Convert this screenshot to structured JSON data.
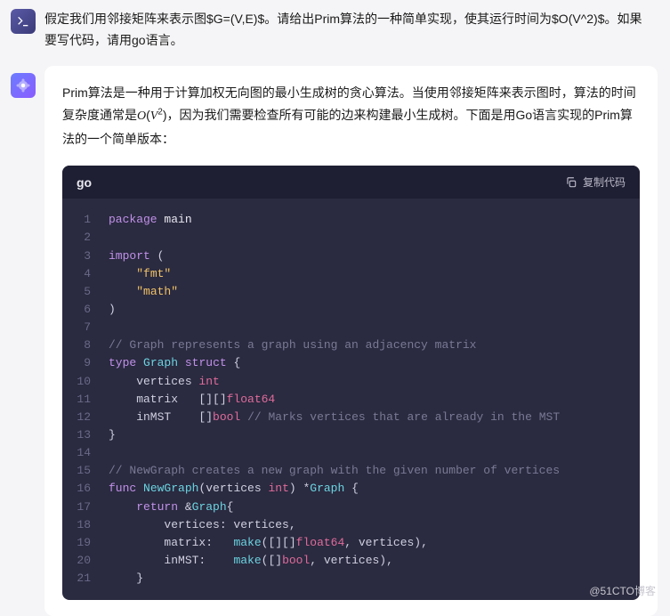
{
  "question": "假定我们用邻接矩阵来表示图$G=(V,E)$。请给出Prim算法的一种简单实现，使其运行时间为$O(V^2)$。如果要写代码，请用go语言。",
  "answer_prefix": "Prim算法是一种用于计算加权无向图的最小生成树的贪心算法。当使用邻接矩阵来表示图时，算法的时间复杂度通常是",
  "answer_math_O": "O",
  "answer_math_V": "V",
  "answer_math_exp": "2",
  "answer_suffix": "，因为我们需要检查所有可能的边来构建最小生成树。下面是用Go语言实现的Prim算法的一个简单版本：",
  "code": {
    "lang": "go",
    "copy_label": "复制代码",
    "lines": [
      {
        "n": "1",
        "seg": [
          {
            "c": "tk-kw",
            "t": "package"
          },
          {
            "c": "",
            "t": " "
          },
          {
            "c": "tk-pkg",
            "t": "main"
          }
        ]
      },
      {
        "n": "2",
        "seg": []
      },
      {
        "n": "3",
        "seg": [
          {
            "c": "tk-kw",
            "t": "import"
          },
          {
            "c": "",
            "t": " ("
          }
        ]
      },
      {
        "n": "4",
        "seg": [
          {
            "c": "",
            "t": "    "
          },
          {
            "c": "tk-str",
            "t": "\"fmt\""
          }
        ]
      },
      {
        "n": "5",
        "seg": [
          {
            "c": "",
            "t": "    "
          },
          {
            "c": "tk-str",
            "t": "\"math\""
          }
        ]
      },
      {
        "n": "6",
        "seg": [
          {
            "c": "",
            "t": ")"
          }
        ]
      },
      {
        "n": "7",
        "seg": []
      },
      {
        "n": "8",
        "seg": [
          {
            "c": "tk-cmt",
            "t": "// Graph represents a graph using an adjacency matrix"
          }
        ]
      },
      {
        "n": "9",
        "seg": [
          {
            "c": "tk-kw",
            "t": "type"
          },
          {
            "c": "",
            "t": " "
          },
          {
            "c": "tk-name",
            "t": "Graph"
          },
          {
            "c": "",
            "t": " "
          },
          {
            "c": "tk-kw",
            "t": "struct"
          },
          {
            "c": "",
            "t": " {"
          }
        ]
      },
      {
        "n": "10",
        "seg": [
          {
            "c": "",
            "t": "    vertices "
          },
          {
            "c": "tk-prim",
            "t": "int"
          }
        ]
      },
      {
        "n": "11",
        "seg": [
          {
            "c": "",
            "t": "    matrix   [][]"
          },
          {
            "c": "tk-prim",
            "t": "float64"
          }
        ]
      },
      {
        "n": "12",
        "seg": [
          {
            "c": "",
            "t": "    inMST    []"
          },
          {
            "c": "tk-prim",
            "t": "bool"
          },
          {
            "c": "",
            "t": " "
          },
          {
            "c": "tk-cmt",
            "t": "// Marks vertices that are already in the MST"
          }
        ]
      },
      {
        "n": "13",
        "seg": [
          {
            "c": "",
            "t": "}"
          }
        ]
      },
      {
        "n": "14",
        "seg": []
      },
      {
        "n": "15",
        "seg": [
          {
            "c": "tk-cmt",
            "t": "// NewGraph creates a new graph with the given number of vertices"
          }
        ]
      },
      {
        "n": "16",
        "seg": [
          {
            "c": "tk-kw",
            "t": "func"
          },
          {
            "c": "",
            "t": " "
          },
          {
            "c": "tk-fn",
            "t": "NewGraph"
          },
          {
            "c": "",
            "t": "(vertices "
          },
          {
            "c": "tk-prim",
            "t": "int"
          },
          {
            "c": "",
            "t": ") *"
          },
          {
            "c": "tk-name",
            "t": "Graph"
          },
          {
            "c": "",
            "t": " {"
          }
        ]
      },
      {
        "n": "17",
        "seg": [
          {
            "c": "",
            "t": "    "
          },
          {
            "c": "tk-kw",
            "t": "return"
          },
          {
            "c": "",
            "t": " &"
          },
          {
            "c": "tk-name",
            "t": "Graph"
          },
          {
            "c": "",
            "t": "{"
          }
        ]
      },
      {
        "n": "18",
        "seg": [
          {
            "c": "",
            "t": "        vertices: vertices,"
          }
        ]
      },
      {
        "n": "19",
        "seg": [
          {
            "c": "",
            "t": "        matrix:   "
          },
          {
            "c": "tk-fn",
            "t": "make"
          },
          {
            "c": "",
            "t": "([][]"
          },
          {
            "c": "tk-prim",
            "t": "float64"
          },
          {
            "c": "",
            "t": ", vertices),"
          }
        ]
      },
      {
        "n": "20",
        "seg": [
          {
            "c": "",
            "t": "        inMST:    "
          },
          {
            "c": "tk-fn",
            "t": "make"
          },
          {
            "c": "",
            "t": "([]"
          },
          {
            "c": "tk-prim",
            "t": "bool"
          },
          {
            "c": "",
            "t": ", vertices),"
          }
        ]
      },
      {
        "n": "21",
        "seg": [
          {
            "c": "",
            "t": "    }"
          }
        ]
      }
    ]
  },
  "watermark": "@51CTO博客"
}
